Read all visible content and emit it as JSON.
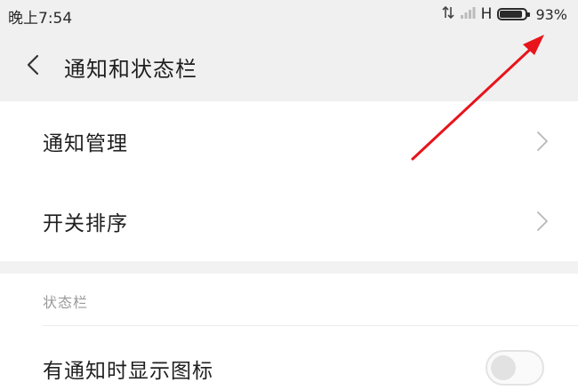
{
  "status_bar": {
    "time": "晚上7:54",
    "network_type": "H",
    "battery_percent": "93%",
    "battery_level": 0.93
  },
  "header": {
    "title": "通知和状态栏"
  },
  "menu": [
    {
      "label": "通知管理"
    },
    {
      "label": "开关排序"
    }
  ],
  "section": {
    "title": "状态栏"
  },
  "toggle_row": {
    "label": "有通知时显示图标",
    "enabled": false
  },
  "icons": {
    "back": "chevron-left-icon",
    "chevron": "chevron-right-icon",
    "data": "data-transfer-icon",
    "signal": "signal-icon",
    "battery": "battery-icon"
  },
  "colors": {
    "annotation_arrow": "#e8141b",
    "background": "#f0f0f0"
  }
}
